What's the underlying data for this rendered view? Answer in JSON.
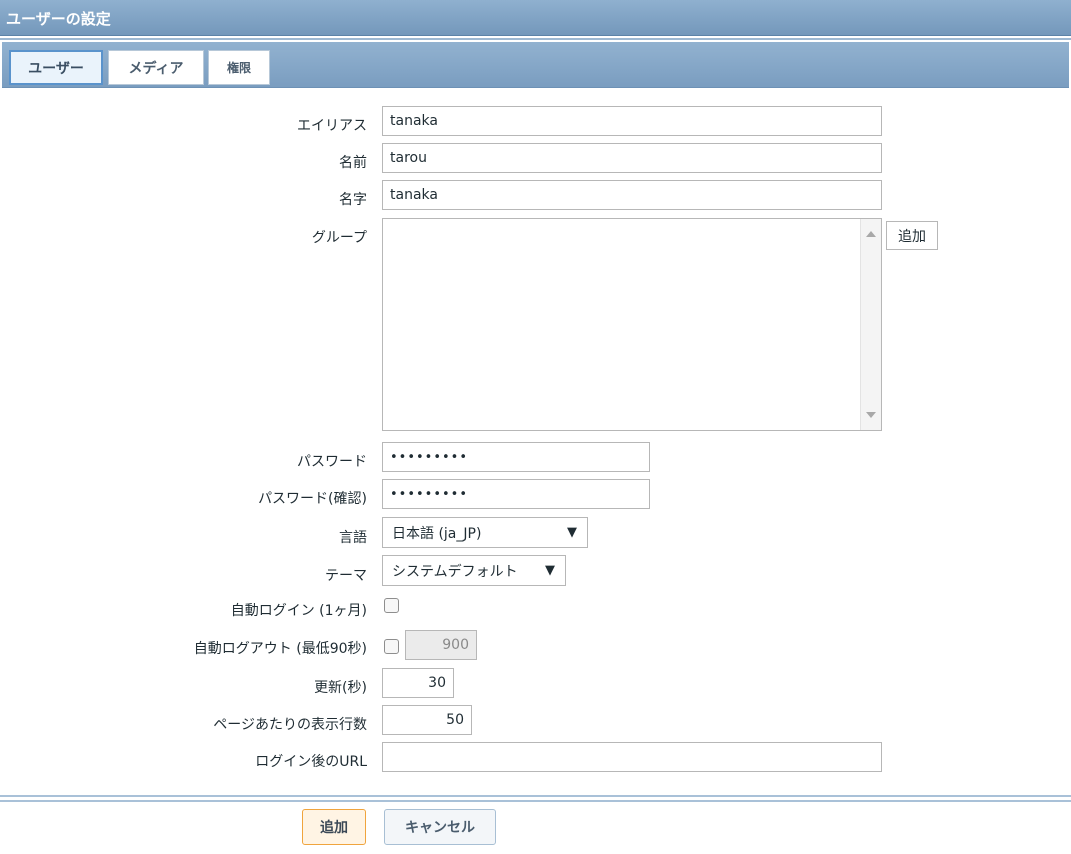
{
  "window": {
    "title": "ユーザーの設定"
  },
  "tabs": [
    {
      "label": "ユーザー",
      "active": true
    },
    {
      "label": "メディア",
      "active": false
    },
    {
      "label": "権限",
      "active": false
    }
  ],
  "form": {
    "alias": {
      "label": "エイリアス",
      "value": "tanaka"
    },
    "name": {
      "label": "名前",
      "value": "tarou"
    },
    "surname": {
      "label": "名字",
      "value": "tanaka"
    },
    "groups": {
      "label": "グループ",
      "add_button": "追加",
      "items": []
    },
    "password": {
      "label": "パスワード",
      "value": "•••••••••"
    },
    "password_confirm": {
      "label": "パスワード(確認)",
      "value": "•••••••••"
    },
    "language": {
      "label": "言語",
      "selected": "日本語 (ja_JP)"
    },
    "theme": {
      "label": "テーマ",
      "selected": "システムデフォルト"
    },
    "autologin": {
      "label": "自動ログイン (1ヶ月)",
      "checked": false
    },
    "autologout": {
      "label": "自動ログアウト (最低90秒)",
      "checked": false,
      "value": "900"
    },
    "refresh": {
      "label": "更新(秒)",
      "value": "30"
    },
    "rows_per_page": {
      "label": "ページあたりの表示行数",
      "value": "50"
    },
    "url": {
      "label": "ログイン後のURL",
      "value": ""
    }
  },
  "buttons": {
    "add": "追加",
    "cancel": "キャンセル"
  },
  "colors": {
    "header_bg": "#7a9dc0",
    "active_tab_border": "#5a93cc",
    "primary_button_border": "#f0a43d"
  }
}
